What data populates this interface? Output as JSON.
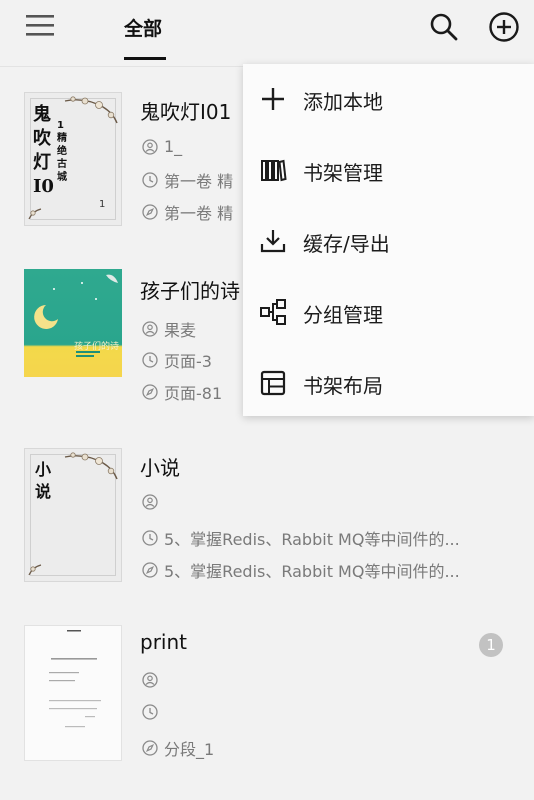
{
  "header": {
    "tab_all": "全部",
    "icons": [
      "menu-icon",
      "search-icon",
      "add-circle-icon"
    ]
  },
  "books": [
    {
      "title": "鬼吹灯I01",
      "cover_text_main": "鬼吹灯I0",
      "cover_text_sub": "1精绝古城",
      "cover_num": "1",
      "author": "1_",
      "progress": "第一卷 精",
      "latest": "第一卷 精"
    },
    {
      "title": "孩子们的诗",
      "cover_caption": "孩子们的诗",
      "author": "果麦",
      "progress": "页面-3",
      "latest": "页面-81"
    },
    {
      "title": "小说",
      "cover_text_main": "小说",
      "author": "",
      "progress": "5、掌握Redis、Rabbit MQ等中间件的...",
      "latest": "5、掌握Redis、Rabbit MQ等中间件的..."
    },
    {
      "title": "print",
      "author": "",
      "progress": "",
      "latest": "分段_1",
      "badge": "1"
    }
  ],
  "menu": {
    "items": [
      {
        "label": "添加本地",
        "icon": "plus-icon"
      },
      {
        "label": "书架管理",
        "icon": "bookshelf-icon"
      },
      {
        "label": "缓存/导出",
        "icon": "download-icon"
      },
      {
        "label": "分组管理",
        "icon": "group-icon"
      },
      {
        "label": "书架布局",
        "icon": "layout-icon"
      }
    ]
  },
  "colors": {
    "background": "#f2f2f2",
    "text": "#111111",
    "meta": "#7a7a7a",
    "badge": "#c2c2c2",
    "menu_bg": "#fbfbfb"
  }
}
